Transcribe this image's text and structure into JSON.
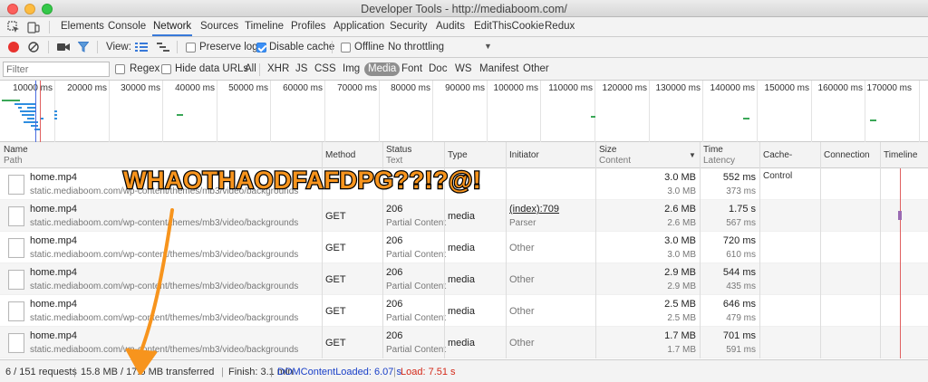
{
  "window": {
    "title": "Developer Tools - http://mediaboom.com/"
  },
  "tabs": [
    "Elements",
    "Console",
    "Network",
    "Sources",
    "Timeline",
    "Profiles",
    "Application",
    "Security",
    "Audits",
    "EditThisCookie",
    "Redux"
  ],
  "toolbar": {
    "view_label": "View:",
    "preserve_log": "Preserve log",
    "preserve_log_checked": false,
    "disable_cache": "Disable cache",
    "disable_cache_checked": true,
    "offline": "Offline",
    "offline_checked": false,
    "throttling": "No throttling"
  },
  "filter": {
    "placeholder": "Filter",
    "regex": "Regex",
    "hide_data_urls": "Hide data URLs",
    "types": [
      "All",
      "XHR",
      "JS",
      "CSS",
      "Img",
      "Media",
      "Font",
      "Doc",
      "WS",
      "Manifest",
      "Other"
    ],
    "active_type": "Media"
  },
  "overview": {
    "ticks": [
      "10000 ms",
      "20000 ms",
      "30000 ms",
      "40000 ms",
      "50000 ms",
      "60000 ms",
      "70000 ms",
      "80000 ms",
      "90000 ms",
      "100000 ms",
      "110000 ms",
      "120000 ms",
      "130000 ms",
      "140000 ms",
      "150000 ms",
      "160000 ms",
      "170000 ms"
    ]
  },
  "table": {
    "headers": {
      "name": "Name",
      "path": "Path",
      "method": "Method",
      "status": "Status",
      "text": "Text",
      "type": "Type",
      "initiator": "Initiator",
      "size": "Size",
      "content": "Content",
      "time": "Time",
      "latency": "Latency",
      "cache_control": "Cache-Control",
      "connection": "Connection",
      "timeline": "Timeline"
    },
    "rows": [
      {
        "name": "home.mp4",
        "path": "static.mediaboom.com/wp-content/themes/mb3/video/backgrounds",
        "method": "",
        "status": "",
        "status_text": "",
        "type": "",
        "initiator": "",
        "initiator_sub": "",
        "size": "3.0 MB",
        "content": "3.0 MB",
        "time": "552 ms",
        "latency": "373 ms"
      },
      {
        "name": "home.mp4",
        "path": "static.mediaboom.com/wp-content/themes/mb3/video/backgrounds",
        "method": "GET",
        "status": "206",
        "status_text": "Partial Content",
        "type": "media",
        "initiator": "(index):709",
        "initiator_sub": "Parser",
        "size": "2.6 MB",
        "content": "2.6 MB",
        "time": "1.75 s",
        "latency": "567 ms"
      },
      {
        "name": "home.mp4",
        "path": "static.mediaboom.com/wp-content/themes/mb3/video/backgrounds",
        "method": "GET",
        "status": "206",
        "status_text": "Partial Content",
        "type": "media",
        "initiator": "Other",
        "initiator_sub": "",
        "size": "3.0 MB",
        "content": "3.0 MB",
        "time": "720 ms",
        "latency": "610 ms"
      },
      {
        "name": "home.mp4",
        "path": "static.mediaboom.com/wp-content/themes/mb3/video/backgrounds",
        "method": "GET",
        "status": "206",
        "status_text": "Partial Content",
        "type": "media",
        "initiator": "Other",
        "initiator_sub": "",
        "size": "2.9 MB",
        "content": "2.9 MB",
        "time": "544 ms",
        "latency": "435 ms"
      },
      {
        "name": "home.mp4",
        "path": "static.mediaboom.com/wp-content/themes/mb3/video/backgrounds",
        "method": "GET",
        "status": "206",
        "status_text": "Partial Content",
        "type": "media",
        "initiator": "Other",
        "initiator_sub": "",
        "size": "2.5 MB",
        "content": "2.5 MB",
        "time": "646 ms",
        "latency": "479 ms"
      },
      {
        "name": "home.mp4",
        "path": "static.mediaboom.com/wp-content/themes/mb3/video/backgrounds",
        "method": "GET",
        "status": "206",
        "status_text": "Partial Content",
        "type": "media",
        "initiator": "Other",
        "initiator_sub": "",
        "size": "1.7 MB",
        "content": "1.7 MB",
        "time": "701 ms",
        "latency": "591 ms"
      }
    ]
  },
  "statusbar": {
    "requests": "6 / 151 requests",
    "transferred": "15.8 MB / 17.6 MB transferred",
    "finish": "Finish: 3.1 min",
    "dom_loaded": "DOMContentLoaded: 6.07 s",
    "load": "Load: 7.51 s"
  },
  "annotation": {
    "text": "WHAOTHAODFAFDPG??!?@!",
    "color": "#f7941d"
  },
  "colors": {
    "accent": "#3879d9",
    "record": "#e8322e",
    "dom_loaded": "#1a40c8",
    "load": "#d42a1a"
  }
}
